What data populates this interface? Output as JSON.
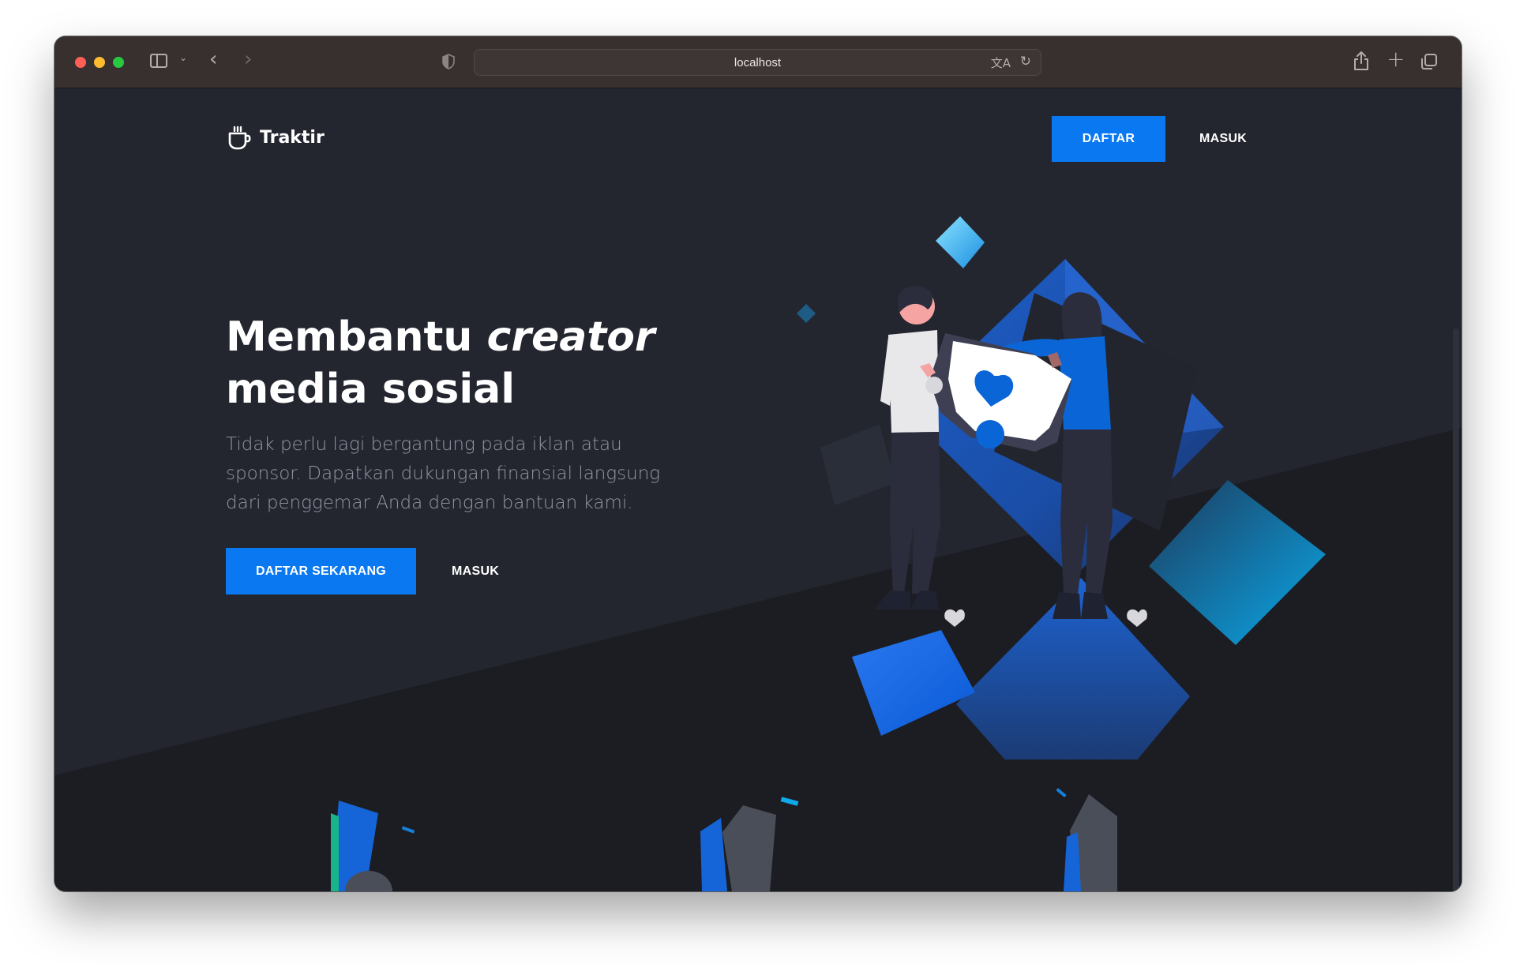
{
  "browser": {
    "url": "localhost"
  },
  "nav": {
    "brand": "Traktir",
    "register_label": "DAFTAR",
    "login_label": "MASUK"
  },
  "hero": {
    "title_part1": "Membantu ",
    "title_emphasis": "creator",
    "title_part2": "media sosial",
    "subtitle": "Tidak perlu lagi bergantung pada iklan atau sponsor. Dapatkan dukungan finansial langsung dari penggemar Anda dengan bantuan kami.",
    "cta_primary": "DAFTAR SEKARANG",
    "cta_secondary": "MASUK"
  },
  "colors": {
    "page_bg": "#23262f",
    "lower_bg": "#1c1d23",
    "accent": "#0a78f0",
    "toolbar_bg": "#37302e"
  },
  "icons": {
    "logo": "coffee-cup-icon",
    "sidebar": "sidebar-toggle-icon",
    "back": "back-arrow-icon",
    "forward": "forward-arrow-icon",
    "privacy": "shield-icon",
    "translate": "translate-icon",
    "reload": "reload-icon",
    "share": "share-icon",
    "new_tab": "plus-icon",
    "tab_overview": "tabs-icon"
  }
}
